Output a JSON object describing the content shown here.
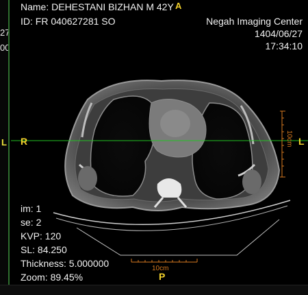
{
  "patient": {
    "name_line": "Name: DEHESTANI BIZHAN M 42Y",
    "id_line": "ID: FR 040627281 SO"
  },
  "facility": {
    "name": "Negah Imaging Center",
    "date": "1404/06/27",
    "time": "17:34:10"
  },
  "adjacent_panel": {
    "fragment_1": "27",
    "fragment_2": "00",
    "orientation_left": "L"
  },
  "orientation": {
    "top": "A",
    "bottom": "P",
    "left": "R",
    "right": "L"
  },
  "scale": {
    "vertical_label": "10cm",
    "horizontal_label": "10cm"
  },
  "image_info": {
    "im": "im: 1",
    "se": "se: 2",
    "kvp": "KVP: 120",
    "sl": "SL: 84.250",
    "thickness": "Thickness: 5.000000",
    "zoom": "Zoom: 89.45%"
  },
  "colors": {
    "marker_yellow": "#f4d22c",
    "reference_line_green": "#22c422",
    "scale_orange": "#d87a1f"
  }
}
